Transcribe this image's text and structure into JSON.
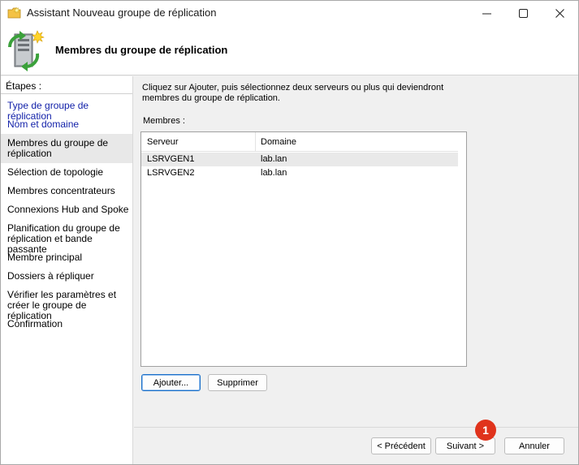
{
  "window": {
    "title": "Assistant Nouveau groupe de réplication",
    "controls": {
      "minimize": "—",
      "maximize": "☐",
      "close": "✕"
    }
  },
  "header": {
    "title": "Membres du groupe de réplication",
    "icon": "server-replication-icon"
  },
  "sidebar": {
    "heading": "Étapes :",
    "steps": [
      {
        "label": "Type de groupe de réplication",
        "state": "link"
      },
      {
        "label": "Nom et domaine",
        "state": "link"
      },
      {
        "label": "Membres du groupe de réplication",
        "state": "current"
      },
      {
        "label": "Sélection de topologie",
        "state": "pending"
      },
      {
        "label": "Membres concentrateurs",
        "state": "pending"
      },
      {
        "label": "Connexions Hub and Spoke",
        "state": "pending"
      },
      {
        "label": "Planification du groupe de réplication et bande passante",
        "state": "pending"
      },
      {
        "label": "Membre principal",
        "state": "pending"
      },
      {
        "label": "Dossiers à répliquer",
        "state": "pending"
      },
      {
        "label": "Vérifier les paramètres et créer le groupe de réplication",
        "state": "pending"
      },
      {
        "label": "Confirmation",
        "state": "pending"
      }
    ]
  },
  "main": {
    "instructions": "Cliquez sur Ajouter, puis sélectionnez deux serveurs ou plus qui deviendront membres du groupe de réplication.",
    "members_label": "Membres :",
    "columns": [
      "Serveur",
      "Domaine"
    ],
    "rows": [
      {
        "server": "LSRVGEN1",
        "domain": "lab.lan"
      },
      {
        "server": "LSRVGEN2",
        "domain": "lab.lan"
      }
    ],
    "add_button": "Ajouter...",
    "remove_button": "Supprimer"
  },
  "footer": {
    "previous_button": "< Précédent",
    "next_button": "Suivant >",
    "cancel_button": "Annuler"
  },
  "annotation": {
    "badge": "1",
    "color": "#e0331c"
  }
}
